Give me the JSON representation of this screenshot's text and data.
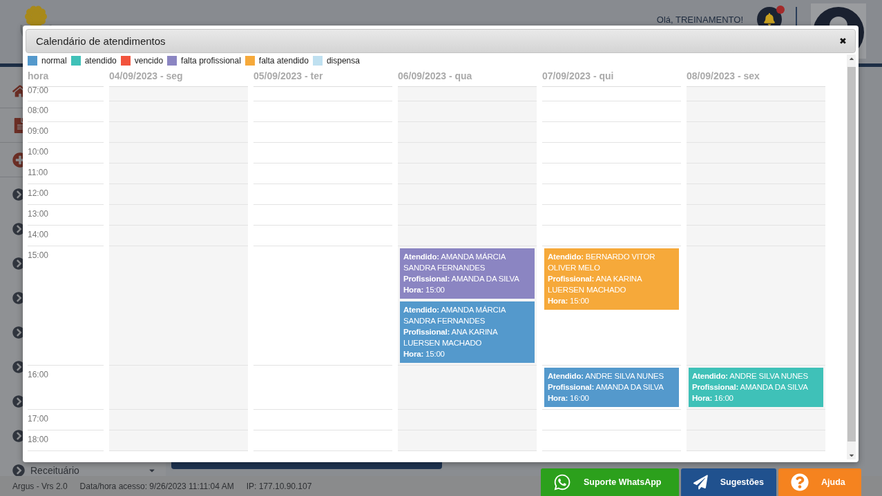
{
  "background_page": {
    "greeting": "Olá, TREINAMENTO!",
    "notifications": {
      "unread": true
    },
    "sidebar": {
      "last_item": "Receituário"
    },
    "status_bar": [
      "Argus - Vrs 2.0",
      "Data/hora acesso: 9/26/2023 11:11:04 AM",
      "IP: 177.10.90.107"
    ],
    "action_buttons": [
      {
        "kind": "whatsapp",
        "label": "Suporte WhatsApp"
      },
      {
        "kind": "suggestions",
        "label": "Sugestões"
      },
      {
        "kind": "help",
        "label": "Ajuda"
      }
    ]
  },
  "dialog": {
    "title": "Calendário de atendimentos",
    "close": "✖",
    "legend": [
      {
        "label": "normal",
        "color": "#5499cc"
      },
      {
        "label": "atendido",
        "color": "#3fc1b8"
      },
      {
        "label": "vencido",
        "color": "#f2533d"
      },
      {
        "label": "falta profissional",
        "color": "#8b85c2"
      },
      {
        "label": "falta atendido",
        "color": "#f6a93a"
      },
      {
        "label": "dispensa",
        "color": "#bfe0f0"
      }
    ],
    "hour_header": "hora",
    "days": [
      "04/09/2023 - seg",
      "05/09/2023 - ter",
      "06/09/2023 - qua",
      "07/09/2023 - qui",
      "08/09/2023 - sex"
    ],
    "rows": [
      {
        "hour": "07:00"
      },
      {
        "hour": "08:00"
      },
      {
        "hour": "09:00"
      },
      {
        "hour": "10:00"
      },
      {
        "hour": "11:00"
      },
      {
        "hour": "12:00"
      },
      {
        "hour": "13:00"
      },
      {
        "hour": "14:00"
      },
      {
        "hour": "15:00",
        "cells": [
          {},
          {},
          {
            "events": [
              {
                "color": "#8b85c2",
                "lines": [
                  "**Atendido:** AMANDA MÁRCIA SANDRA FERNANDES",
                  "**Profissional:** AMANDA DA SILVA",
                  "**Hora:** 15:00"
                ]
              },
              {
                "color": "#5499cc",
                "lines": [
                  "**Atendido:** AMANDA MÁRCIA SANDRA FERNANDES",
                  "**Profissional:** ANA KARINA LUERSEN MACHADO",
                  "**Hora:** 15:00"
                ]
              }
            ]
          },
          {
            "events": [
              {
                "color": "#f6a93a",
                "lines": [
                  "**Atendido:** BERNARDO VITOR OLIVER MELO",
                  "**Profissional:** ANA KARINA LUERSEN MACHADO",
                  "**Hora:** 15:00"
                ]
              }
            ]
          },
          {}
        ]
      },
      {
        "hour": "16:00",
        "cells": [
          {},
          {},
          {},
          {
            "events": [
              {
                "color": "#5499cc",
                "lines": [
                  "**Atendido:** ANDRE SILVA NUNES",
                  "**Profissional:** AMANDA DA SILVA",
                  "**Hora:** 16:00"
                ]
              }
            ]
          },
          {
            "events": [
              {
                "color": "#3fc1b8",
                "lines": [
                  "**Atendido:** ANDRE SILVA NUNES",
                  "**Profissional:** AMANDA DA SILVA",
                  "**Hora:** 16:00"
                ]
              }
            ]
          }
        ]
      },
      {
        "hour": "17:00"
      },
      {
        "hour": "18:00"
      }
    ]
  }
}
